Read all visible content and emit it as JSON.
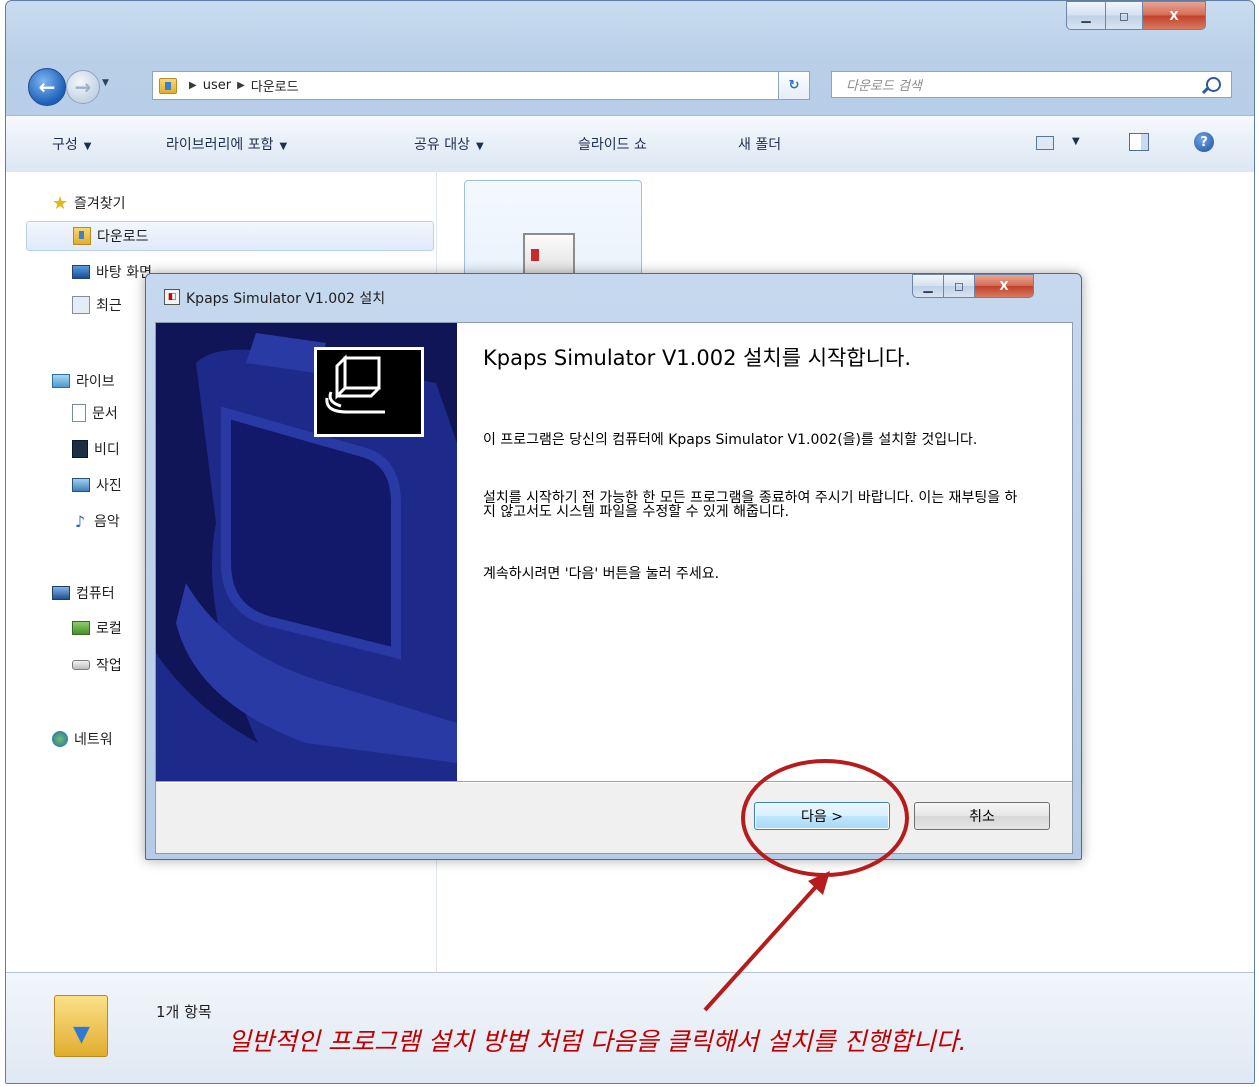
{
  "explorer": {
    "caption_buttons": {
      "minimize": "▁",
      "maximize": "◻",
      "close": "X"
    },
    "address": {
      "root_arrow": "▶",
      "segments": [
        "user",
        "다운로드"
      ]
    },
    "search": {
      "placeholder": "다운로드 검색"
    },
    "commands": [
      {
        "label": "구성",
        "has_dropdown": true
      },
      {
        "label": "라이브러리에 포함",
        "has_dropdown": true
      },
      {
        "label": "공유 대상",
        "has_dropdown": true
      },
      {
        "label": "슬라이드 쇼",
        "has_dropdown": false
      },
      {
        "label": "새 폴더",
        "has_dropdown": false
      }
    ],
    "help_label": "?",
    "nav": {
      "favorites": "즐겨찾기",
      "downloads": "다운로드",
      "desktop": "바탕 화면",
      "recent": "최근",
      "libraries": "라이브",
      "documents": "문서",
      "videos": "비디",
      "pictures": "사진",
      "music": "음악",
      "computer": "컴퓨터",
      "local_disk": "로컬",
      "work": "작업",
      "network": "네트워"
    },
    "status": {
      "item_count": "1개 항목"
    }
  },
  "installer": {
    "title": "Kpaps Simulator V1.002 설치",
    "heading": "Kpaps Simulator V1.002 설치를 시작합니다.",
    "paragraphs": [
      "이 프로그램은 당신의 컴퓨터에 Kpaps Simulator V1.002(을)를 설치할 것입니다.",
      "설치를 시작하기 전 가능한 한 모든 프로그램을 종료하여 주시기 바랍니다. 이는 재부팅을 하지 않고서도 시스템 파일을 수정할 수 있게 해줍니다.",
      "계속하시려면 '다음' 버튼을 눌러 주세요."
    ],
    "next_button": "다음 >",
    "cancel_button": "취소"
  },
  "annotation": {
    "text": "일반적인 프로그램 설치 방법 처럼 다음을 클릭해서 설치를 진행합니다.",
    "color": "#c00000"
  }
}
